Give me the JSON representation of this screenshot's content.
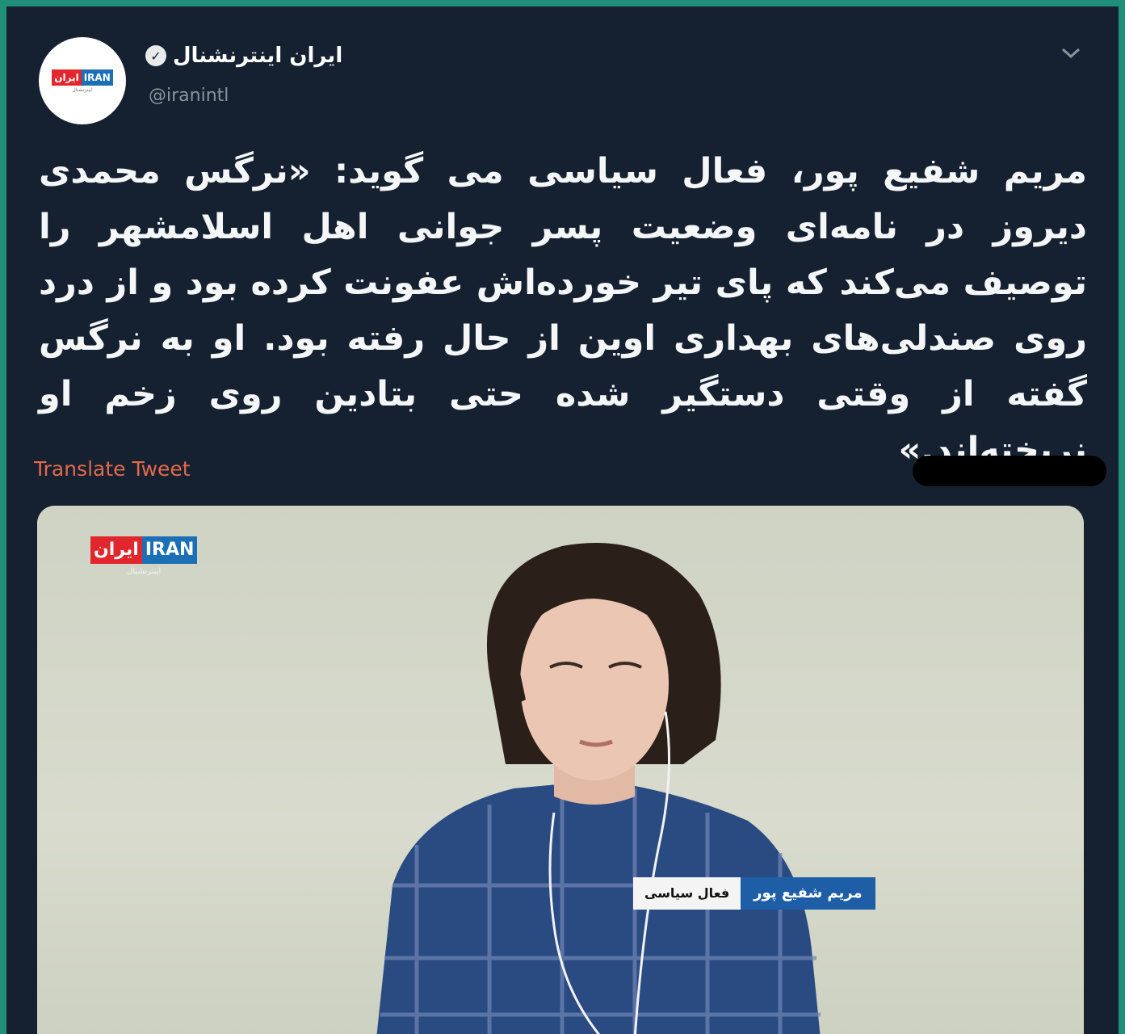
{
  "tweet": {
    "account_name": "ایران اینترنشنال",
    "handle": "@iranintl",
    "text": "مریم شفیع پور، فعال سیاسی می گوید: «نرگس محمدی دیروز در نامه‌ای وضعیت پسر جوانی اهل اسلامشهر را توصیف می‌کند که پای تیر خورده‌اش عفونت کرده بود و از درد روی صندلی‌های بهداری اوین از حال رفته بود. او به نرگس گفته از وقتی دستگیر شده حتی بتادین روی زخم او نریخته‌اند.»",
    "translate_label": "Translate Tweet",
    "verified": true
  },
  "logo": {
    "fa": "ایران",
    "en": "IRAN",
    "sub": "اینترنشنال"
  },
  "video": {
    "lower_third_name": "مریم شفیع پور",
    "lower_third_title": "فعال سیاسی"
  },
  "colors": {
    "background": "#152130",
    "link": "#e3694a",
    "brand_red": "#e1262d",
    "brand_blue": "#1a6fb5"
  },
  "icons": [
    "verified-badge-icon",
    "chevron-down-icon"
  ]
}
